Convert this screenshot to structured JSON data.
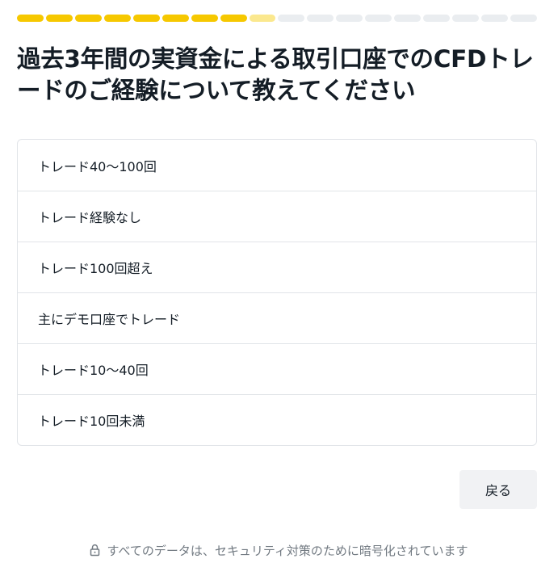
{
  "progress": {
    "total_steps": 18,
    "completed_steps": 8,
    "current_step": 9,
    "colors": {
      "done": "#f6c800",
      "current": "#fbe88e",
      "todo": "#eaedf0"
    }
  },
  "question": {
    "title": "過去3年間の実資金による取引口座でのCFDトレードのご経験について教えてください"
  },
  "options": [
    {
      "label": "トレード40～100回"
    },
    {
      "label": "トレード経験なし"
    },
    {
      "label": "トレード100回超え"
    },
    {
      "label": "主にデモ口座でトレード"
    },
    {
      "label": "トレード10～40回"
    },
    {
      "label": "トレード10回未満"
    }
  ],
  "actions": {
    "back_label": "戻る"
  },
  "footer": {
    "icon": "lock-icon",
    "security_note": "すべてのデータは、セキュリティ対策のために暗号化されています"
  }
}
